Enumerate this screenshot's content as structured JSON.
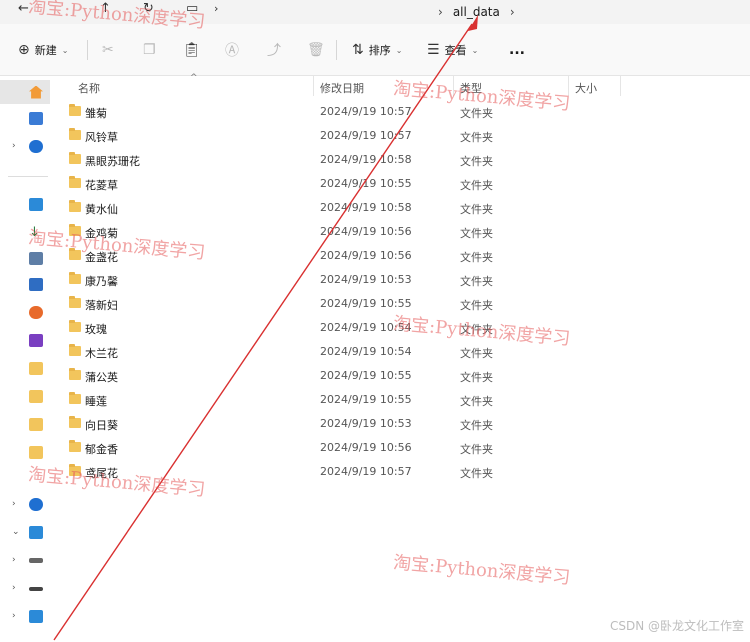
{
  "address": {
    "current": "all_data"
  },
  "toolbar": {
    "new_label": "新建",
    "sort_label": "排序",
    "view_label": "查看",
    "more_label": "..."
  },
  "columns": {
    "name": "名称",
    "modified": "修改日期",
    "type": "类型",
    "size": "大小"
  },
  "files": [
    {
      "name": "雏菊",
      "modified": "2024/9/19 10:57",
      "type": "文件夹"
    },
    {
      "name": "风铃草",
      "modified": "2024/9/19 10:57",
      "type": "文件夹"
    },
    {
      "name": "黑眼苏珊花",
      "modified": "2024/9/19 10:58",
      "type": "文件夹"
    },
    {
      "name": "花菱草",
      "modified": "2024/9/19 10:55",
      "type": "文件夹"
    },
    {
      "name": "黄水仙",
      "modified": "2024/9/19 10:58",
      "type": "文件夹"
    },
    {
      "name": "金鸡菊",
      "modified": "2024/9/19 10:56",
      "type": "文件夹"
    },
    {
      "name": "金盏花",
      "modified": "2024/9/19 10:56",
      "type": "文件夹"
    },
    {
      "name": "康乃馨",
      "modified": "2024/9/19 10:53",
      "type": "文件夹"
    },
    {
      "name": "落新妇",
      "modified": "2024/9/19 10:55",
      "type": "文件夹"
    },
    {
      "name": "玫瑰",
      "modified": "2024/9/19 10:54",
      "type": "文件夹"
    },
    {
      "name": "木兰花",
      "modified": "2024/9/19 10:54",
      "type": "文件夹"
    },
    {
      "name": "蒲公英",
      "modified": "2024/9/19 10:55",
      "type": "文件夹"
    },
    {
      "name": "睡莲",
      "modified": "2024/9/19 10:55",
      "type": "文件夹"
    },
    {
      "name": "向日葵",
      "modified": "2024/9/19 10:53",
      "type": "文件夹"
    },
    {
      "name": "郁金香",
      "modified": "2024/9/19 10:56",
      "type": "文件夹"
    },
    {
      "name": "鸢尾花",
      "modified": "2024/9/19 10:57",
      "type": "文件夹"
    }
  ],
  "watermark": {
    "text": "淘宝:Python深度学习"
  },
  "credit": "CSDN @卧龙文化工作室",
  "colors": {
    "folder": "#f2c55c",
    "annotation_arrow": "#d93030",
    "watermark": "#e65a5a"
  }
}
